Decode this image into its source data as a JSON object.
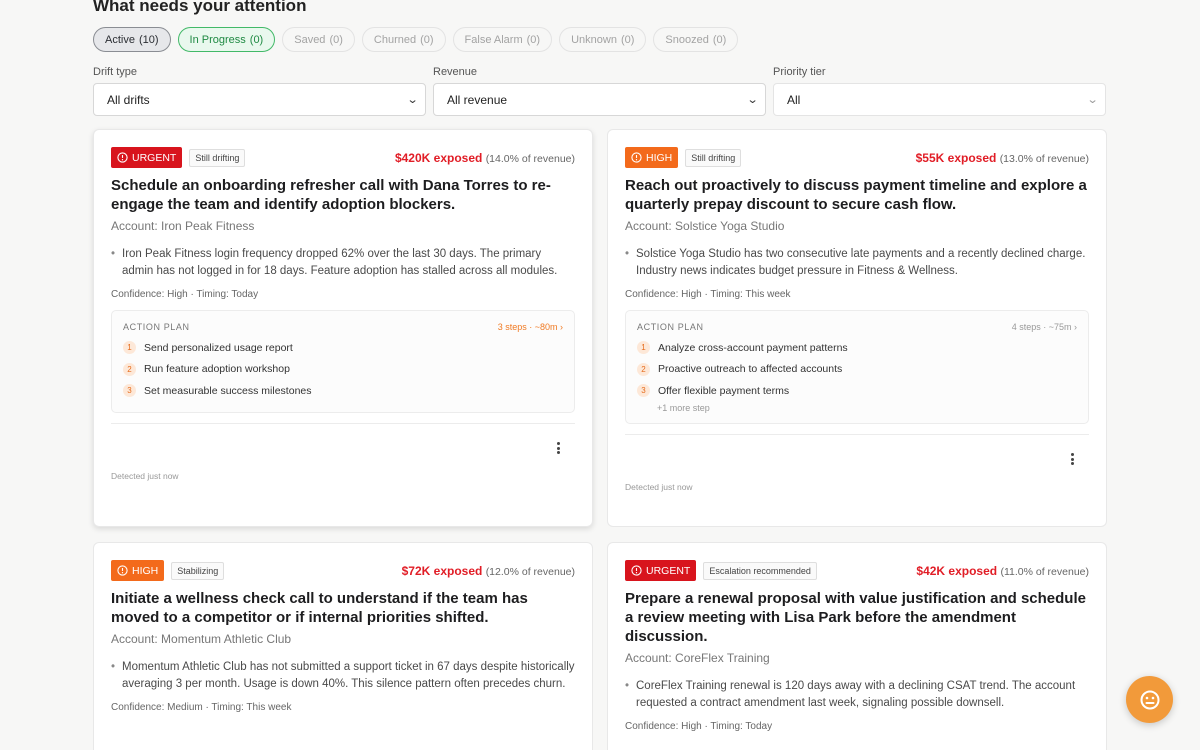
{
  "heading": "What needs your attention",
  "tabs": [
    {
      "label": "Active",
      "count": "(10)"
    },
    {
      "label": "In Progress",
      "count": "(0)"
    },
    {
      "label": "Saved",
      "count": "(0)"
    },
    {
      "label": "Churned",
      "count": "(0)"
    },
    {
      "label": "False Alarm",
      "count": "(0)"
    },
    {
      "label": "Unknown",
      "count": "(0)"
    },
    {
      "label": "Snoozed",
      "count": "(0)"
    }
  ],
  "filters": [
    {
      "label": "Drift type",
      "value": "All drifts"
    },
    {
      "label": "Revenue",
      "value": "All revenue"
    },
    {
      "label": "Priority tier",
      "value": "All"
    }
  ],
  "cards": [
    {
      "priority": "URGENT",
      "status": "Still drifting",
      "amount": "$420K exposed",
      "pct": "(14.0% of revenue)",
      "title": "Schedule an onboarding refresher call with Dana Torres to re-engage the team and identify adoption blockers.",
      "account": "Account: Iron Peak Fitness",
      "bullet": "Iron Peak Fitness login frequency dropped 62% over the last 30 days. The primary admin has not logged in for 18 days. Feature adoption has stalled across all modules.",
      "confidence": "Confidence: High · Timing: Today",
      "plan_title": "ACTION PLAN",
      "plan_meta": "3 steps · ~80m",
      "steps": [
        "Send personalized usage report",
        "Run feature adoption workshop",
        "Set measurable success milestones"
      ],
      "more": "",
      "detected": "Detected just now"
    },
    {
      "priority": "HIGH",
      "status": "Still drifting",
      "amount": "$55K exposed",
      "pct": "(13.0% of revenue)",
      "title": "Reach out proactively to discuss payment timeline and explore a quarterly prepay discount to secure cash flow.",
      "account": "Account: Solstice Yoga Studio",
      "bullet": "Solstice Yoga Studio has two consecutive late payments and a recently declined charge. Industry news indicates budget pressure in Fitness & Wellness.",
      "confidence": "Confidence: High · Timing: This week",
      "plan_title": "ACTION PLAN",
      "plan_meta": "4 steps · ~75m",
      "steps": [
        "Analyze cross-account payment patterns",
        "Proactive outreach to affected accounts",
        "Offer flexible payment terms"
      ],
      "more": "+1 more step",
      "detected": "Detected just now"
    },
    {
      "priority": "HIGH",
      "status": "Stabilizing",
      "amount": "$72K exposed",
      "pct": "(12.0% of revenue)",
      "title": "Initiate a wellness check call to understand if the team has moved to a competitor or if internal priorities shifted.",
      "account": "Account: Momentum Athletic Club",
      "bullet": "Momentum Athletic Club has not submitted a support ticket in 67 days despite historically averaging 3 per month. Usage is down 40%. This silence pattern often precedes churn.",
      "confidence": "Confidence: Medium · Timing: This week"
    },
    {
      "priority": "URGENT",
      "status": "Escalation recommended",
      "amount": "$42K exposed",
      "pct": "(11.0% of revenue)",
      "title": "Prepare a renewal proposal with value justification and schedule a review meeting with Lisa Park before the amendment discussion.",
      "account": "Account: CoreFlex Training",
      "bullet": "CoreFlex Training renewal is 120 days away with a declining CSAT trend. The account requested a contract amendment last week, signaling possible downsell.",
      "confidence": "Confidence: High · Timing: Today"
    }
  ],
  "icons": {
    "priority": "alert-circle-icon",
    "menu": "kebab-menu-icon",
    "fab": "assistant-icon",
    "chevron": "chevron-down-icon"
  },
  "colors": {
    "urgent": "#d8141d",
    "high": "#f36a1b",
    "exposed": "#e11d26",
    "in_progress": "#42b968",
    "fab": "#f29a3a"
  }
}
